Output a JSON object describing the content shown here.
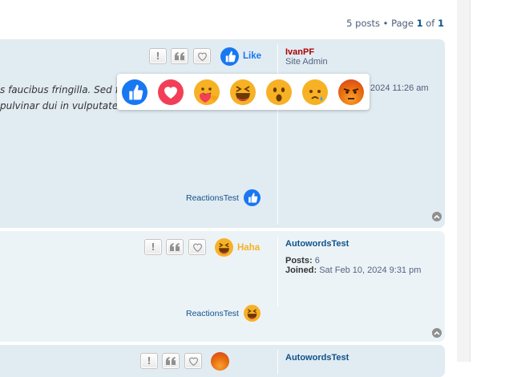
{
  "pagination": {
    "posts_text": "5 posts • Page ",
    "current": "1",
    "of_text": " of ",
    "total": "1"
  },
  "posts": [
    {
      "author": "IvanPF",
      "author_color": "#aa0000",
      "rank": "Site Admin",
      "text_line1": "s faucibus fringilla. Sed fe",
      "text_line2": "pulvinar dui in vulputate",
      "timestamp": "2024 11:26 am",
      "reaction_label": "Like",
      "reaction_color": "#1877f2",
      "reactions_user": "ReactionsTest",
      "reactions_user_icon": "like-icon"
    },
    {
      "author": "AutowordsTest",
      "author_color": "#105289",
      "posts_label": "Posts:",
      "posts_value": "6",
      "joined_label": "Joined:",
      "joined_value": "Sat Feb 10, 2024 9:31 pm",
      "reaction_label": "Haha",
      "reaction_color": "#f7b125",
      "reactions_user": "ReactionsTest",
      "reactions_user_icon": "haha-icon"
    },
    {
      "author": "AutowordsTest",
      "author_color": "#105289"
    }
  ],
  "reaction_picker": [
    "like-icon",
    "love-icon",
    "care-icon",
    "haha-icon",
    "wow-icon",
    "sad-icon",
    "angry-icon"
  ],
  "buttons": {
    "report": "!",
    "quote": "quote-icon",
    "react": "heart-outline-icon"
  }
}
